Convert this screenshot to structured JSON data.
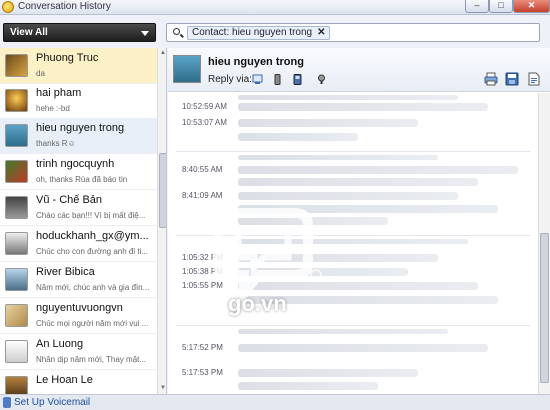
{
  "window": {
    "title": "Conversation History",
    "close_glyph": "✕",
    "min_glyph": "–",
    "max_glyph": "□"
  },
  "filter": {
    "label": "View All"
  },
  "search": {
    "chip_label": "Contact: hieu nguyen trong",
    "chip_close": "✕"
  },
  "contacts": [
    {
      "name": "Phuong Truc",
      "status": "da"
    },
    {
      "name": "hai pham",
      "status": "hehe :-bd"
    },
    {
      "name": "hieu nguyen trong",
      "status": "thanks R☺"
    },
    {
      "name": "trinh ngocquynh",
      "status": "oh, thanks Rùa đã báo tin"
    },
    {
      "name": "Vũ - Chế Bản",
      "status": "Chào các bạn!!! Vì bị mất điệ..."
    },
    {
      "name": "hoduckhanh_gx@ym...",
      "status": "Chúc cho con đường anh đi ti..."
    },
    {
      "name": "River Bibica",
      "status": "Năm mới, chúc anh và gia đìn..."
    },
    {
      "name": "nguyentuvuongvn",
      "status": "Chúc mọi người năm mới vui ..."
    },
    {
      "name": "An Luong",
      "status": "Nhân dịp năm mới, Thay mặt..."
    },
    {
      "name": "Le Hoan Le",
      "status": ""
    }
  ],
  "footer": {
    "voicemail_label": "Set Up Voicemail"
  },
  "conversation": {
    "name": "hieu nguyen trong",
    "reply_label": "Reply via:",
    "timestamps": [
      "10:52:59 AM",
      "10:53:07 AM",
      "8:40:55 AM",
      "8:41:09 AM",
      "1:05:32 PM",
      "1:05:38 PM",
      "1:05:55 PM",
      "5:17:52 PM",
      "5:17:53 PM"
    ]
  },
  "watermark": {
    "text": "go.vn"
  },
  "colors": {
    "selected_contact": "#fbf0c6",
    "current_contact": "#e8eff9",
    "close_button": "#c4412b",
    "link": "#1e4fa3"
  },
  "icons": [
    "app-icon",
    "search-icon",
    "im-icon",
    "mobile-icon",
    "sms-icon",
    "call-icon",
    "print-icon",
    "save-icon",
    "export-icon",
    "voicemail-icon"
  ]
}
